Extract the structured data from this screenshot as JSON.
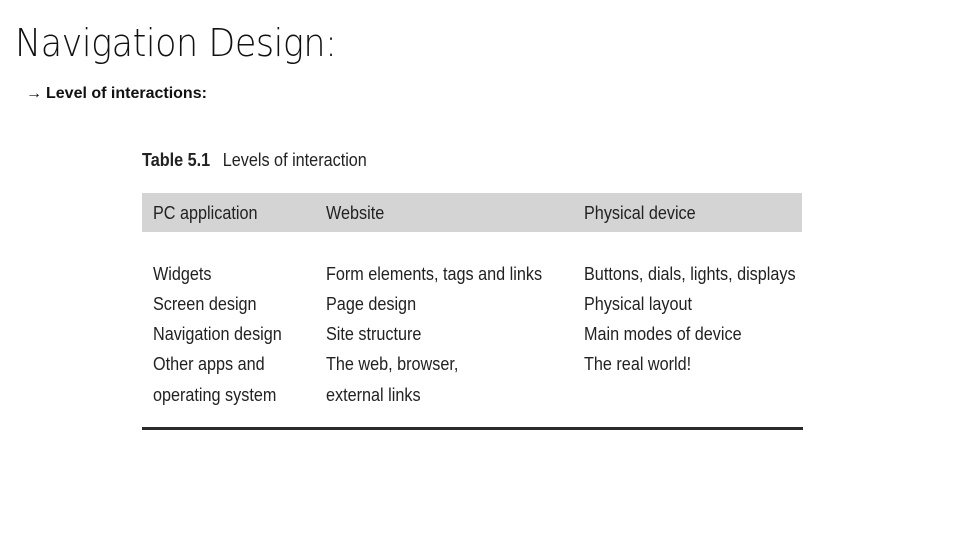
{
  "slide": {
    "title": "Navigation Design:",
    "subtitle_arrow": "→",
    "subtitle": "Level of interactions:"
  },
  "table": {
    "caption_label": "Table 5.1",
    "caption_text": "Levels of interaction",
    "headers": [
      "PC application",
      "Website",
      "Physical device"
    ],
    "rows": [
      [
        "Widgets",
        "Form elements, tags and links",
        "Buttons, dials, lights, displays"
      ],
      [
        "Screen design",
        "Page design",
        "Physical layout"
      ],
      [
        "Navigation design",
        "Site structure",
        "Main modes of device"
      ],
      [
        "Other apps and",
        "The web, browser,",
        "The real world!"
      ],
      [
        "operating system",
        "external links",
        ""
      ]
    ]
  },
  "colors": {
    "header_band": "#d4d4d4",
    "rule": "#2a2a2a"
  }
}
